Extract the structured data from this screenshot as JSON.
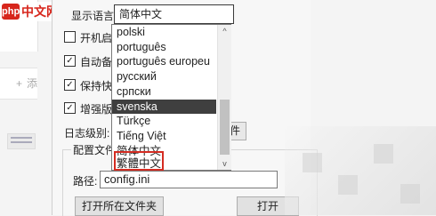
{
  "watermark": {
    "badge": "php",
    "brand": "中文网"
  },
  "sidebar": {
    "add_plus": "+",
    "add_label": "添"
  },
  "settings": {
    "language_label": "显示语言:",
    "language_value": "简体中文",
    "checkboxes": [
      {
        "label": "开机启",
        "checked": false,
        "mark": ""
      },
      {
        "label": "自动备",
        "checked": true,
        "mark": "✓"
      },
      {
        "label": "保持快",
        "checked": true,
        "mark": "✓"
      },
      {
        "label": "增强版",
        "checked": true,
        "mark": "✓"
      }
    ],
    "log_level_label": "日志级别:",
    "partial_button_label": "件"
  },
  "config_group": {
    "title": "配置文件",
    "path_label": "路径:",
    "path_value": "config.ini",
    "open_folder_button": "打开所在文件夹",
    "open_button": "打开"
  },
  "language_dropdown": {
    "items": [
      "polski",
      "português",
      "português europeu",
      "русский",
      "српски",
      "svenska",
      "Türkçe",
      "Tiếng Việt",
      "简体中文",
      "繁體中文"
    ],
    "selected_index": 5,
    "highlighted_item": "繁體中文",
    "scroll_up_glyph": "^",
    "scroll_down_glyph": "v"
  },
  "colors": {
    "highlight_border": "#d42c22",
    "selected_bg": "#3f3f3f",
    "brand": "#d7261c"
  }
}
